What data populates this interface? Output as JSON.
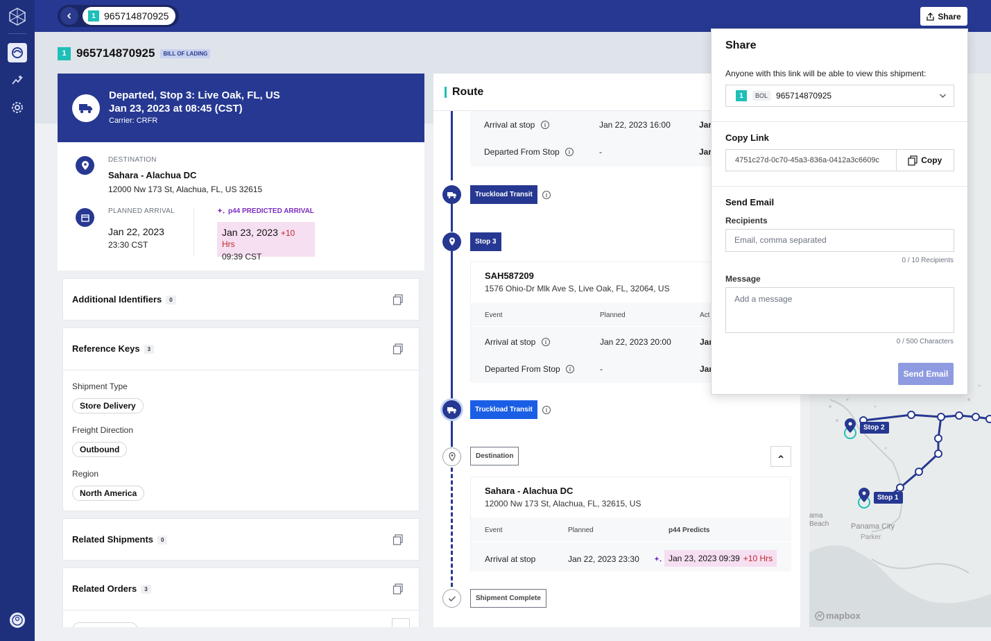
{
  "header": {
    "shipment_id": "965714870925",
    "badge": "1",
    "share_label": "Share"
  },
  "page": {
    "title": "965714870925",
    "badge": "1",
    "bol_tag": "BILL OF LADING"
  },
  "status": {
    "line1": "Departed, Stop 3: Live Oak, FL, US",
    "line2": "Jan 23, 2023 at 08:45 (CST)",
    "carrier": "Carrier: CRFR"
  },
  "destination": {
    "label": "DESTINATION",
    "name": "Sahara - Alachua DC",
    "address": "12000 Nw 173 St, Alachua, FL, US 32615",
    "planned_label": "PLANNED ARRIVAL",
    "planned_date": "Jan 22, 2023",
    "planned_time": "23:30 CST",
    "predicted_label": "p44 PREDICTED ARRIVAL",
    "predicted_date": "Jan 23, 2023",
    "predicted_delta": "+10 Hrs",
    "predicted_time": "09:39 CST"
  },
  "sections": {
    "additional": {
      "title": "Additional Identifiers",
      "count": "0"
    },
    "reference": {
      "title": "Reference Keys",
      "count": "3",
      "fields": [
        {
          "label": "Shipment Type",
          "value": "Store Delivery"
        },
        {
          "label": "Freight Direction",
          "value": "Outbound"
        },
        {
          "label": "Region",
          "value": "North America"
        }
      ]
    },
    "related_shipments": {
      "title": "Related Shipments",
      "count": "0"
    },
    "related_orders": {
      "title": "Related Orders",
      "count": "3"
    }
  },
  "route": {
    "title": "Route",
    "stop_prev": {
      "rows": [
        {
          "event": "Arrival at stop",
          "planned": "Jan 22, 2023 16:00",
          "actual": "Jar"
        },
        {
          "event": "Departed From Stop",
          "planned": "-",
          "actual": "Jar"
        }
      ]
    },
    "transit1": "Truckload Transit",
    "stop3": {
      "tag": "Stop 3",
      "code": "SAH587209",
      "address": "1576 Ohio-Dr Mlk Ave S, Live Oak, FL, 32064, US",
      "headers": [
        "Event",
        "Planned",
        "Act"
      ],
      "rows": [
        {
          "event": "Arrival at stop",
          "planned": "Jan 22, 2023 20:00",
          "actual": "Jar"
        },
        {
          "event": "Departed From Stop",
          "planned": "-",
          "actual": "Jar"
        }
      ]
    },
    "transit2": "Truckload Transit",
    "destination": {
      "tag": "Destination",
      "name": "Sahara - Alachua DC",
      "address": "12000 Nw 173 St, Alachua, FL, 32615, US",
      "headers": [
        "Event",
        "Planned",
        "p44 Predicts"
      ],
      "row": {
        "event": "Arrival at stop",
        "planned": "Jan 22, 2023 23:30",
        "predicted": "Jan 23, 2023 09:39",
        "delta": "+10 Hrs"
      }
    },
    "complete": "Shipment Complete"
  },
  "map": {
    "stop2": "Stop 2",
    "stop1": "Stop 1",
    "place1": "Panama City",
    "place2": "Parker",
    "place3": "ama",
    "place4": "Beach",
    "brand": "mapbox"
  },
  "share": {
    "title": "Share",
    "intro": "Anyone with this link will be able to view this shipment:",
    "select_badge": "1",
    "select_tag": "BOL",
    "select_value": "965714870925",
    "copy_title": "Copy Link",
    "link_value": "4751c27d-0c70-45a3-836a-0412a3c6609c",
    "copy_label": "Copy",
    "email_title": "Send Email",
    "recipients_label": "Recipients",
    "recipients_placeholder": "Email, comma separated",
    "recipients_meta": "0 / 10 Recipients",
    "message_label": "Message",
    "message_placeholder": "Add a message",
    "message_meta": "0 / 500 Characters",
    "send_label": "Send Email"
  },
  "colors": {
    "nav": "#1e2f7c",
    "topbar": "#263891",
    "teal": "#1fbfb8",
    "predict_bg": "#f6dff1",
    "delta": "#c0262d",
    "purple": "#7b2cbf"
  }
}
